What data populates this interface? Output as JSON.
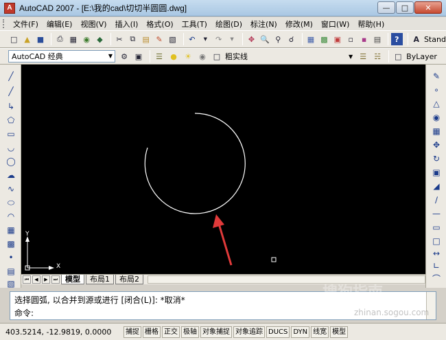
{
  "window": {
    "title": "AutoCAD 2007 - [E:\\我的cad\\切切半圆圆.dwg]",
    "app_icon_label": "A"
  },
  "menu": [
    "文件(F)",
    "编辑(E)",
    "视图(V)",
    "插入(I)",
    "格式(O)",
    "工具(T)",
    "绘图(D)",
    "标注(N)",
    "修改(M)",
    "窗口(W)",
    "帮助(H)"
  ],
  "toolbar2": {
    "workspace": "AutoCAD 经典",
    "layer": "粗实线",
    "color": "ByLayer"
  },
  "toolbar1": {
    "style_label": "Stand"
  },
  "layout_tabs": [
    "模型",
    "布局1",
    "布局2"
  ],
  "command": {
    "history": "选择圆弧, 以合并到源或进行 [闭合(L)]:  *取消*",
    "prompt": "命令:"
  },
  "status": {
    "coords": "403.5214, -12.9819, 0.0000",
    "buttons": [
      "捕捉",
      "栅格",
      "正交",
      "极轴",
      "对象捕捉",
      "对象追踪",
      "DUCS",
      "DYN",
      "线宽",
      "模型"
    ]
  },
  "ucs": {
    "x_label": "X",
    "y_label": "Y"
  },
  "watermark": {
    "main": "搜狗指南",
    "sub": "zhinan.sogou.com"
  },
  "colors": {
    "canvas": "#000000",
    "arc": "#ffffff",
    "arrow": "#e03a3a"
  }
}
